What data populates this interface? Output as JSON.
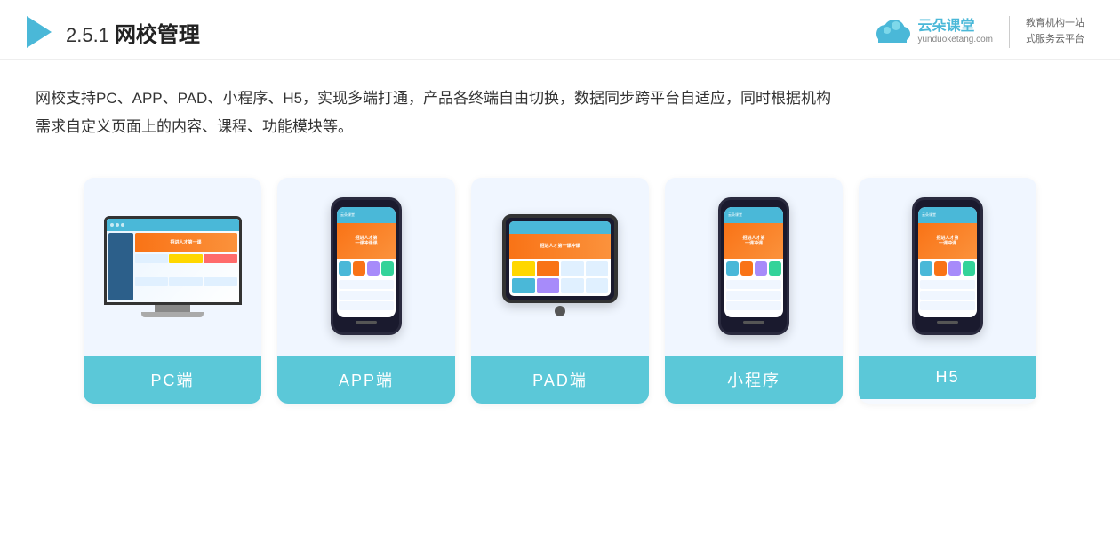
{
  "header": {
    "title_prefix": "2.5.1",
    "title_main": "网校管理",
    "logo": {
      "name": "云朵课堂",
      "url": "yunduoketang.com",
      "slogan_line1": "教育机构一站",
      "slogan_line2": "式服务云平台"
    }
  },
  "description": {
    "text_line1": "网校支持PC、APP、PAD、小程序、H5，实现多端打通，产品各终端自由切换，数据同步跨平台自适应，同时根据机构",
    "text_line2": "需求自定义页面上的内容、课程、功能模块等。"
  },
  "cards": [
    {
      "id": "pc",
      "label": "PC端"
    },
    {
      "id": "app",
      "label": "APP端"
    },
    {
      "id": "pad",
      "label": "PAD端"
    },
    {
      "id": "miniprogram",
      "label": "小程序"
    },
    {
      "id": "h5",
      "label": "H5"
    }
  ]
}
